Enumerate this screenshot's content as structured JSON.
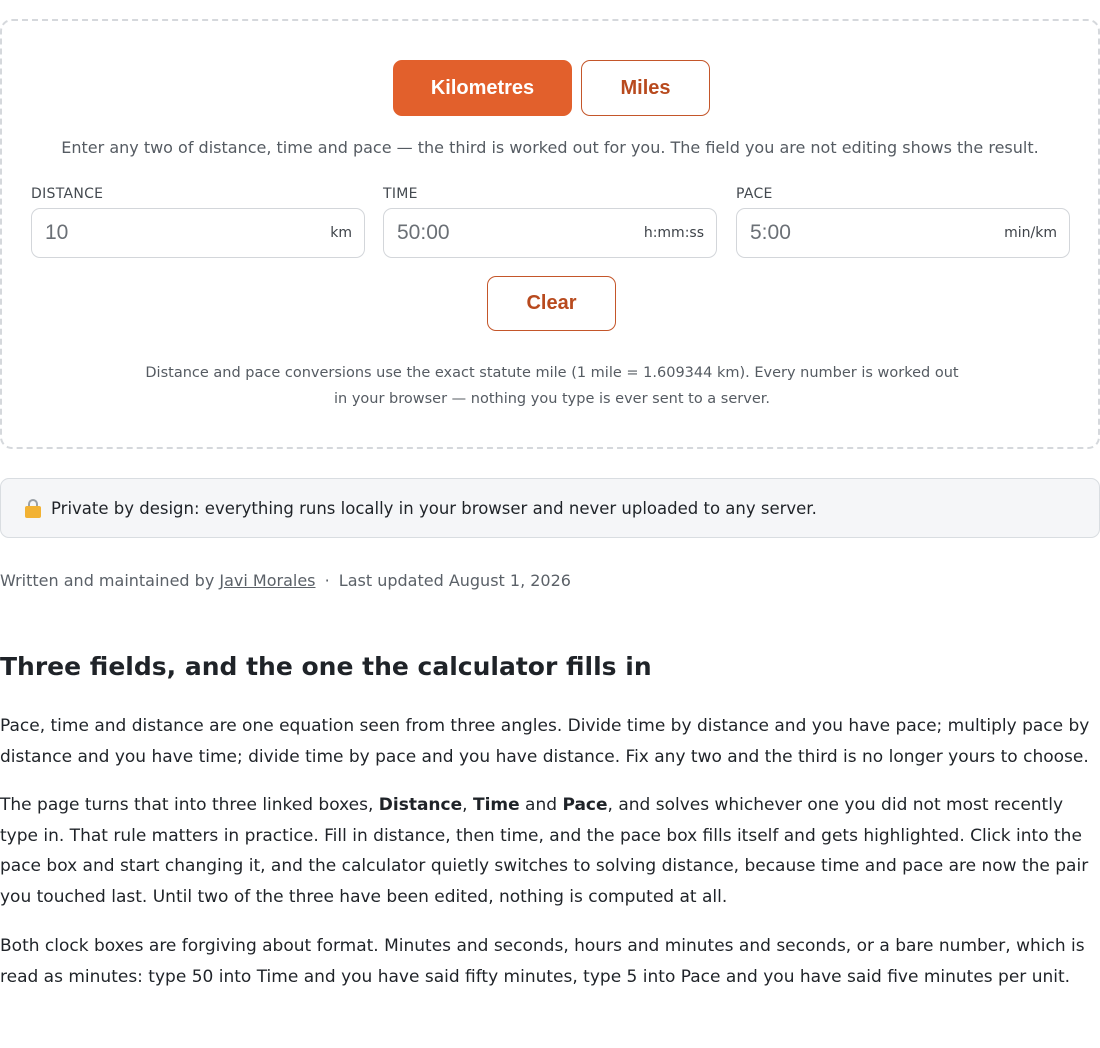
{
  "units": {
    "kilometres_label": "Kilometres",
    "miles_label": "Miles",
    "active": "Kilometres"
  },
  "instructions": "Enter any two of distance, time and pace — the third is worked out for you. The field you are not editing shows the result.",
  "fields": {
    "distance": {
      "label": "DISTANCE",
      "value": "10",
      "unit": "km"
    },
    "time": {
      "label": "TIME",
      "value": "50:00",
      "unit": "h:mm:ss"
    },
    "pace": {
      "label": "PACE",
      "value": "5:00",
      "unit": "min/km"
    }
  },
  "clear_label": "Clear",
  "footnote": "Distance and pace conversions use the exact statute mile (1 mile = 1.609344 km). Every number is worked out in your browser — nothing you type is ever sent to a server.",
  "privacy_text": "Private by design: everything runs locally in your browser and never uploaded to any server.",
  "byline": {
    "prefix": "Written and maintained by",
    "author": "Javi Morales",
    "separator": "·",
    "updated": "Last updated August 1, 2026"
  },
  "article": {
    "heading": "Three fields, and the one the calculator fills in",
    "p1": "Pace, time and distance are one equation seen from three angles. Divide time by distance and you have pace; multiply pace by distance and you have time; divide time by pace and you have distance. Fix any two and the third is no longer yours to choose.",
    "p2_a": "The page turns that into three linked boxes,",
    "p2_b1": "Distance",
    "p2_c1": ",",
    "p2_b2": "Time",
    "p2_c2": "and",
    "p2_b3": "Pace",
    "p2_d": ", and solves whichever one you did not most recently type in. That rule matters in practice. Fill in distance, then time, and the pace box fills itself and gets highlighted. Click into the pace box and start changing it, and the calculator quietly switches to solving distance, because time and pace are now the pair you touched last. Until two of the three have been edited, nothing is computed at all.",
    "p3": "Both clock boxes are forgiving about format. Minutes and seconds, hours and minutes and seconds, or a bare number, which is read as minutes: type 50 into Time and you have said fifty minutes, type 5 into Pace and you have said five minutes per unit."
  }
}
